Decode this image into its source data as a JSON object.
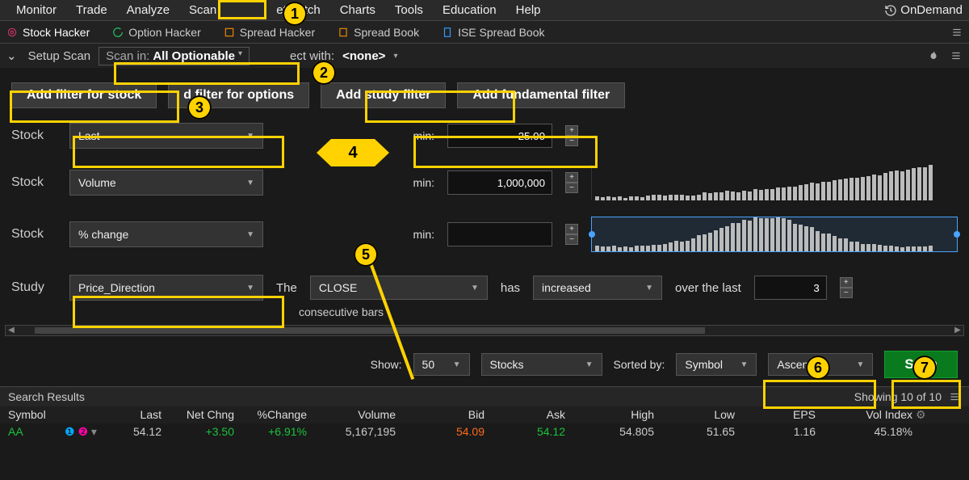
{
  "topmenu": {
    "items": [
      "Monitor",
      "Trade",
      "Analyze",
      "Scan",
      "etWatch",
      "Charts",
      "Tools",
      "Education",
      "Help"
    ],
    "ondemand": "OnDemand"
  },
  "subtabs": {
    "items": [
      "Stock Hacker",
      "Option Hacker",
      "Spread Hacker",
      "Spread Book",
      "ISE Spread Book"
    ]
  },
  "setup": {
    "label": "Setup Scan",
    "scanin_lbl": "Scan in:",
    "scanin_val": "All Optionable",
    "intersect_lbl": "ect with:",
    "intersect_val": "<none>"
  },
  "filterbtns": {
    "stock": "Add filter for stock",
    "options": "d filter for options",
    "study": "Add study filter",
    "fundamental": "Add fundamental filter"
  },
  "rows": {
    "r1": {
      "cat": "Stock",
      "field": "Last",
      "minlbl": "min:",
      "min": "25.00"
    },
    "r2": {
      "cat": "Stock",
      "field": "Volume",
      "minlbl": "min:",
      "min": "1,000,000"
    },
    "r3": {
      "cat": "Stock",
      "field": "% change",
      "minlbl": "min:",
      "min": ""
    },
    "study": {
      "cat": "Study",
      "field": "Price_Direction",
      "the": "The",
      "priceType": "CLOSE",
      "has": "has",
      "direction": "increased",
      "over": "over the last",
      "count": "3",
      "consec": "consecutive bars"
    }
  },
  "sort": {
    "showlbl": "Show:",
    "show_n": "50",
    "show_type": "Stocks",
    "sortedlbl": "Sorted by:",
    "sort_col": "Symbol",
    "sort_dir": "Ascending",
    "scan": "Scan"
  },
  "results": {
    "title": "Search Results",
    "showing": "Showing 10 of 10",
    "cols": [
      "Symbol",
      "Last",
      "Net Chng",
      "%Change",
      "Volume",
      "Bid",
      "Ask",
      "High",
      "Low",
      "EPS",
      "Vol Index"
    ],
    "row": {
      "sym": "AA",
      "last": "54.12",
      "netc": "+3.50",
      "pchg": "+6.91%",
      "vol": "5,167,195",
      "bid": "54.09",
      "ask": "54.12",
      "high": "54.805",
      "low": "51.65",
      "eps": "1.16",
      "vix": "45.18%"
    }
  },
  "annotations": {
    "n1": "1",
    "n2": "2",
    "n3": "3",
    "n4": "4",
    "n5": "5",
    "n6": "6",
    "n7": "7"
  }
}
